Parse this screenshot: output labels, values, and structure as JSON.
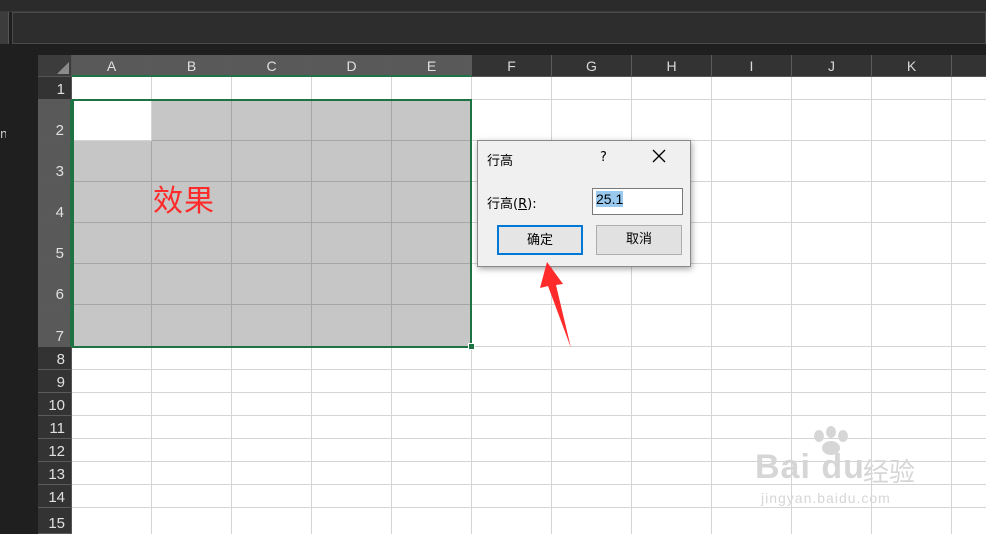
{
  "spreadsheet": {
    "columns": [
      "A",
      "B",
      "C",
      "D",
      "E",
      "F",
      "G",
      "H",
      "I",
      "J",
      "K"
    ],
    "selected_columns": [
      "A",
      "B",
      "C",
      "D",
      "E"
    ],
    "rows": [
      "1",
      "2",
      "3",
      "4",
      "5",
      "6",
      "7",
      "8",
      "9",
      "10",
      "11",
      "12",
      "13",
      "14",
      "15"
    ],
    "selected_rows": [
      "2",
      "3",
      "4",
      "5",
      "6",
      "7"
    ],
    "sidebar_fragment": "n",
    "effect_label": "效果",
    "selection_border_color": "#1f7244",
    "selection_fill_color": "#c6c6c6"
  },
  "dialog": {
    "title": "行高",
    "help": "?",
    "close_icon": "close-icon",
    "field_label_prefix": "行高(",
    "field_label_mnemonic": "R",
    "field_label_suffix": "):",
    "field_value": "25.1",
    "ok_label": "确定",
    "cancel_label": "取消",
    "ok_border_color": "#0078d7"
  },
  "annotation": {
    "arrow_color": "#ff2a2a"
  },
  "watermark": {
    "logo": "Bai du",
    "chinese": "经验",
    "url": "jingyan.baidu.com"
  }
}
